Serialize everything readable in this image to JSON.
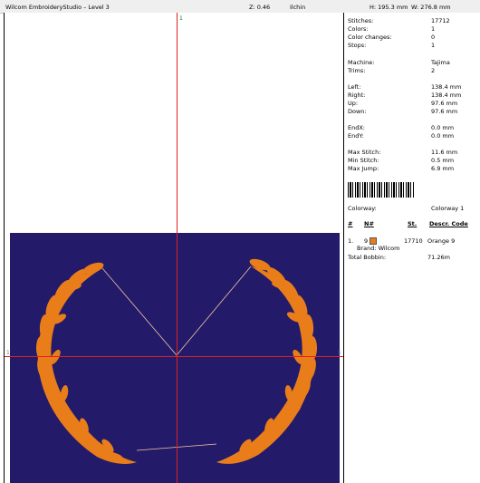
{
  "title": "Wilcom EmbroideryStudio – Level 3",
  "zoom": "Z: 0.46",
  "units": "ilchin",
  "height": "H: 195.3 mm",
  "width": "W: 276.8 mm",
  "axis": {
    "top": "1",
    "left": "1",
    "right": "1"
  },
  "colors": {
    "fabric": "#231a6a",
    "thread": "#e87d1a",
    "guide": "#e02020"
  },
  "stats": [
    {
      "label": "Stitches:",
      "value": "17712"
    },
    {
      "label": "Colors:",
      "value": "1"
    },
    {
      "label": "Color changes:",
      "value": "0"
    },
    {
      "label": "Stops:",
      "value": "1"
    },
    {
      "label": "Machine:",
      "value": "Tajima"
    },
    {
      "label": "Trims:",
      "value": "2"
    },
    {
      "label": "Left:",
      "value": "138.4 mm"
    },
    {
      "label": "Right:",
      "value": "138.4 mm"
    },
    {
      "label": "Up:",
      "value": "97.6 mm"
    },
    {
      "label": "Down:",
      "value": "97.6 mm"
    },
    {
      "label": "EndX:",
      "value": "0.0 mm"
    },
    {
      "label": "EndY:",
      "value": "0.0 mm"
    },
    {
      "label": "Max Stitch:",
      "value": "11.6 mm"
    },
    {
      "label": "Min Stitch:",
      "value": "0.5 mm"
    },
    {
      "label": "Max Jump:",
      "value": "6.9 mm"
    }
  ],
  "colorway": {
    "label": "Colorway:",
    "value": "Colorway 1"
  },
  "table": {
    "headers": [
      "#",
      "N#",
      "St.",
      "Descr. Code"
    ],
    "rows": [
      {
        "num": "1.",
        "needle": "9",
        "stitches": "17710",
        "desc": "Orange 9"
      }
    ]
  },
  "brand": "Brand: Wilcom",
  "bobbin": {
    "label": "Total Bobbin:",
    "value": "71.26m"
  }
}
